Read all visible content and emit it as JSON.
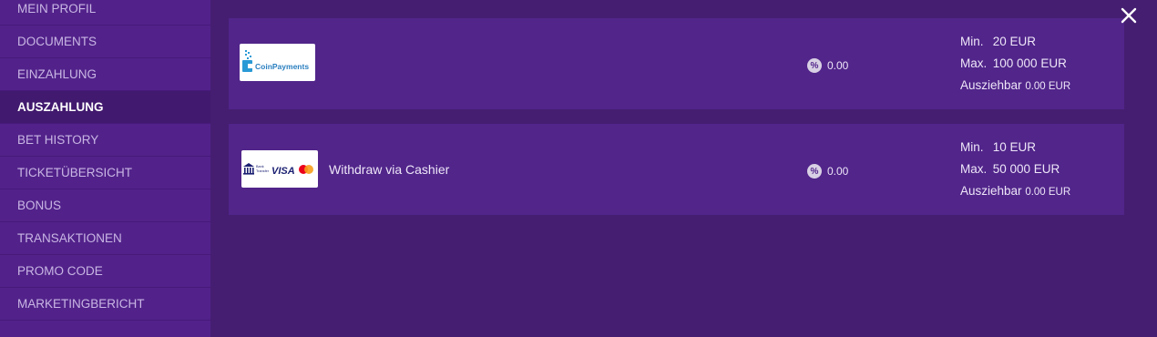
{
  "sidebar": {
    "items": [
      {
        "label": "MEIN PROFIL"
      },
      {
        "label": "DOCUMENTS"
      },
      {
        "label": "EINZAHLUNG"
      },
      {
        "label": "AUSZAHLUNG",
        "active": true
      },
      {
        "label": "BET HISTORY"
      },
      {
        "label": "TICKETÜBERSICHT"
      },
      {
        "label": "BONUS"
      },
      {
        "label": "TRANSAKTIONEN"
      },
      {
        "label": "PROMO CODE"
      },
      {
        "label": "MARKETINGBERICHT"
      }
    ]
  },
  "methods": [
    {
      "logo": "CoinPayments",
      "name": "",
      "fee": "0.00",
      "min_label": "Min.",
      "min": "20 EUR",
      "max_label": "Max.",
      "max": "100 000 EUR",
      "available_label": "Ausziehbar",
      "available": "0.00 EUR"
    },
    {
      "logo_text_bank": "Bank Transfer",
      "logo_text_visa": "VISA",
      "name": "Withdraw via Cashier",
      "fee": "0.00",
      "min_label": "Min.",
      "min": "10 EUR",
      "max_label": "Max.",
      "max": "50 000 EUR",
      "available_label": "Ausziehbar",
      "available": "0.00 EUR"
    }
  ],
  "icons": {
    "fee": "percent-icon",
    "close": "close-icon"
  },
  "colors": {
    "background": "#451e71",
    "sidebar": "#52228a",
    "card": "#51258a",
    "active_item": "#41196e",
    "coinpayments_blue": "#2a9ad6",
    "visa_blue": "#1a1f71",
    "mc_red": "#eb001b",
    "mc_orange": "#f79e1b"
  }
}
